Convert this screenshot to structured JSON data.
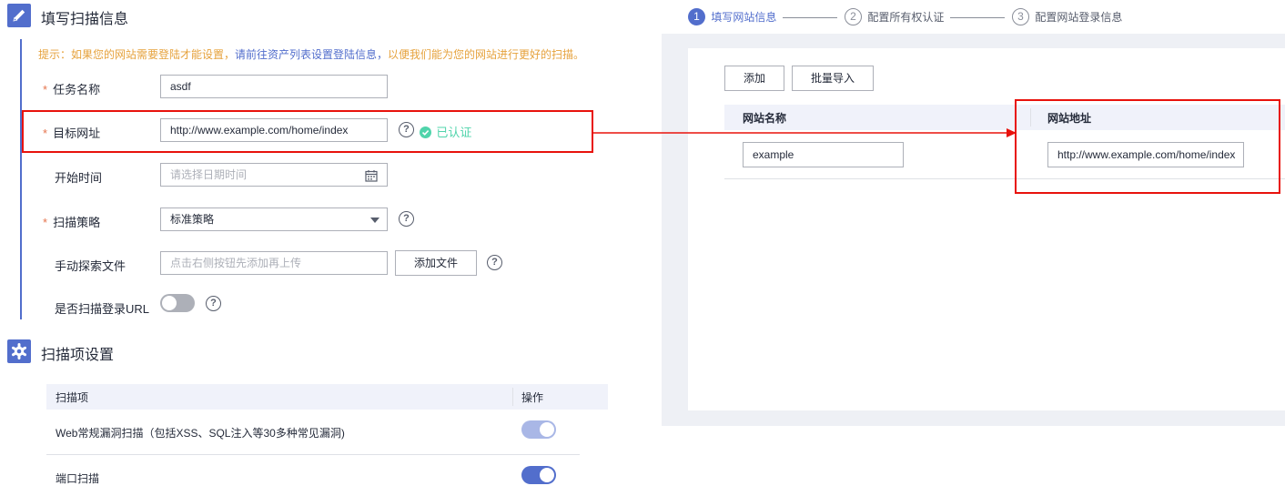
{
  "form_section": {
    "title": "填写扫描信息",
    "hint": {
      "prefix": "提示：如果您的网站需要登陆才能设置，",
      "link": "请前往资产列表设置登陆信息，",
      "suffix": "以便我们能为您的网站进行更好的扫描。"
    },
    "fields": {
      "task_name": {
        "label": "任务名称",
        "value": "asdf"
      },
      "target_url": {
        "label": "目标网址",
        "value": "http://www.example.com/home/index",
        "verified": "已认证"
      },
      "start_time": {
        "label": "开始时间",
        "placeholder": "请选择日期时间"
      },
      "scan_policy": {
        "label": "扫描策略",
        "value": "标准策略"
      },
      "manual_files": {
        "label": "手动探索文件",
        "placeholder": "点击右侧按钮先添加再上传",
        "button": "添加文件"
      },
      "scan_login_url": {
        "label": "是否扫描登录URL",
        "on": false
      }
    },
    "required_mark": "*",
    "help_glyph": "?"
  },
  "scan_items_section": {
    "title": "扫描项设置",
    "headers": {
      "item": "扫描项",
      "action": "操作"
    },
    "rows": [
      {
        "name": "Web常规漏洞扫描（包括XSS、SQL注入等30多种常见漏洞)",
        "on": true,
        "disabled": true
      },
      {
        "name": "端口扫描",
        "on": true,
        "disabled": false
      }
    ]
  },
  "wizard": {
    "steps": [
      {
        "num": "1",
        "label": "填写网站信息",
        "active": true
      },
      {
        "num": "2",
        "label": "配置所有权认证",
        "active": false
      },
      {
        "num": "3",
        "label": "配置网站登录信息",
        "active": false
      }
    ],
    "buttons": {
      "add": "添加",
      "batch_import": "批量导入"
    },
    "table": {
      "headers": {
        "name": "网站名称",
        "url": "网站地址"
      },
      "row": {
        "name": "example",
        "url": "http://www.example.com/home/index"
      }
    }
  },
  "colors": {
    "primary": "#526ecc",
    "highlight": "#e8120c",
    "success": "#50d4ab",
    "warning": "#e6a23c"
  },
  "icons": {
    "form_section": "pencil-icon",
    "scan_items_section": "gear-icon",
    "start_time": "calendar-icon",
    "scan_policy": "caret-down-icon",
    "verified": "check-circle-icon"
  }
}
